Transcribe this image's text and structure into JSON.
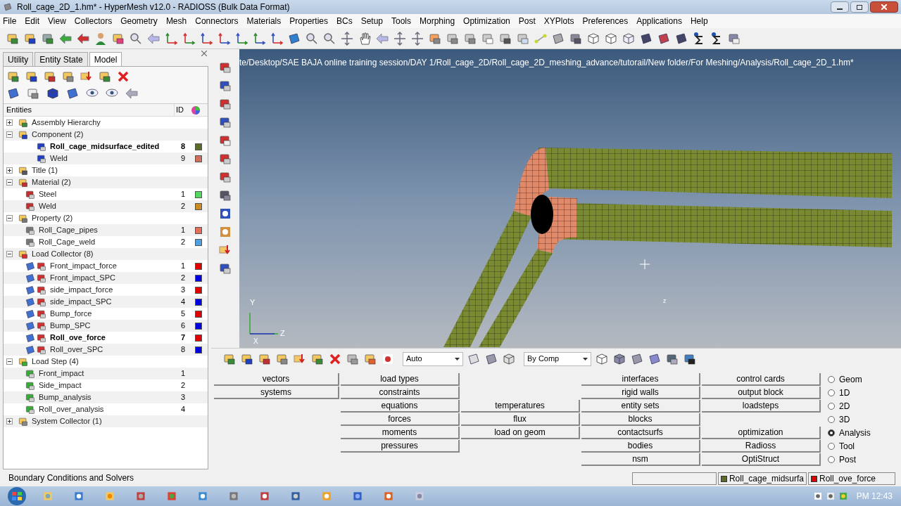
{
  "window": {
    "title": "Roll_cage_2D_1.hm* - HyperMesh v12.0 - RADIOSS (Bulk Data Format)"
  },
  "menu": [
    "File",
    "Edit",
    "View",
    "Collectors",
    "Geometry",
    "Mesh",
    "Connectors",
    "Materials",
    "Properties",
    "BCs",
    "Setup",
    "Tools",
    "Morphing",
    "Optimization",
    "Post",
    "XYPlots",
    "Preferences",
    "Applications",
    "Help"
  ],
  "browser": {
    "tabs": [
      {
        "label": "Utility",
        "selected": false
      },
      {
        "label": "Entity State",
        "selected": false
      },
      {
        "label": "Model",
        "selected": true
      }
    ],
    "columns": [
      "Entities",
      "ID"
    ],
    "tree": [
      {
        "label": "Assembly Hierarchy",
        "kind": "assembly",
        "expanded": false
      },
      {
        "label": "Component (2)",
        "kind": "component",
        "expanded": true,
        "children": [
          {
            "label": "Roll_cage_midsurface_edited",
            "kind": "component",
            "id": "8",
            "color": "#5a6b2a",
            "current": true
          },
          {
            "label": "Weld",
            "kind": "component",
            "id": "9",
            "color": "#d0705a",
            "current": false
          }
        ]
      },
      {
        "label": "Title (1)",
        "kind": "title",
        "expanded": false
      },
      {
        "label": "Material (2)",
        "kind": "material",
        "expanded": true,
        "children": [
          {
            "label": "Steel",
            "kind": "material",
            "id": "1",
            "color": "#50d860",
            "current": false
          },
          {
            "label": "Weld",
            "kind": "material",
            "id": "2",
            "color": "#c88c20",
            "current": false
          }
        ]
      },
      {
        "label": "Property (2)",
        "kind": "property",
        "expanded": true,
        "children": [
          {
            "label": "Roll_Cage_pipes",
            "kind": "property",
            "id": "1",
            "color": "#e07058",
            "current": false
          },
          {
            "label": "Roll_Cage_weld",
            "kind": "property",
            "id": "2",
            "color": "#50a0e0",
            "current": false
          }
        ]
      },
      {
        "label": "Load Collector (8)",
        "kind": "loadcol",
        "expanded": true,
        "children": [
          {
            "label": "Front_impact_force",
            "kind": "loadcol",
            "id": "1",
            "color": "#e00000",
            "current": false
          },
          {
            "label": "Front_impact_SPC",
            "kind": "loadcol",
            "id": "2",
            "color": "#0000e0",
            "current": false
          },
          {
            "label": "side_impact_force",
            "kind": "loadcol",
            "id": "3",
            "color": "#e00000",
            "current": false
          },
          {
            "label": "side_impact_SPC",
            "kind": "loadcol",
            "id": "4",
            "color": "#0000e0",
            "current": false
          },
          {
            "label": "Bump_force",
            "kind": "loadcol",
            "id": "5",
            "color": "#e00000",
            "current": false
          },
          {
            "label": "Bump_SPC",
            "kind": "loadcol",
            "id": "6",
            "color": "#0000e0",
            "current": false
          },
          {
            "label": "Roll_ove_force",
            "kind": "loadcol",
            "id": "7",
            "color": "#e00000",
            "current": true
          },
          {
            "label": "Roll_over_SPC",
            "kind": "loadcol",
            "id": "8",
            "color": "#0000e0",
            "current": false
          }
        ]
      },
      {
        "label": "Load Step (4)",
        "kind": "loadstep",
        "expanded": true,
        "children": [
          {
            "label": "Front_impact",
            "kind": "loadstep",
            "id": "1",
            "current": false
          },
          {
            "label": "Side_impact",
            "kind": "loadstep",
            "id": "2",
            "current": false
          },
          {
            "label": "Bump_analysis",
            "kind": "loadstep",
            "id": "3",
            "current": false
          },
          {
            "label": "Roll_over_analysis",
            "kind": "loadstep",
            "id": "4",
            "current": false
          }
        ]
      },
      {
        "label": "System Collector (1)",
        "kind": "system",
        "expanded": false
      }
    ]
  },
  "viewport": {
    "file_path": "te/Desktop/SAE BAJA online training session/DAY 1/Roll_cage_2D/Roll_cage_2D_meshing_advance/tutorail/New folder/For Meshing/Analysis/Roll_cage_2D_1.hm*",
    "axes": [
      "Y",
      "X",
      "Z"
    ],
    "marker_label": "z"
  },
  "bottom_toolbar": {
    "combos": [
      "Auto",
      "By Comp"
    ]
  },
  "panel": {
    "columns": [
      [
        {
          "label": "vectors"
        },
        {
          "label": "systems"
        },
        null,
        null,
        null,
        null,
        null
      ],
      [
        {
          "label": "load types"
        },
        {
          "label": "constraints"
        },
        {
          "label": "equations"
        },
        {
          "label": "forces"
        },
        {
          "label": "moments"
        },
        {
          "label": "pressures"
        },
        null
      ],
      [
        null,
        null,
        {
          "label": "temperatures"
        },
        {
          "label": "flux"
        },
        {
          "label": "load on geom"
        },
        null,
        null
      ],
      [
        {
          "label": "interfaces"
        },
        {
          "label": "rigid walls"
        },
        {
          "label": "entity sets"
        },
        {
          "label": "blocks"
        },
        {
          "label": "contactsurfs"
        },
        {
          "label": "bodies"
        },
        {
          "label": "nsm"
        }
      ],
      [
        {
          "label": "control cards"
        },
        {
          "label": "output block"
        },
        {
          "label": "loadsteps"
        },
        null,
        {
          "label": "optimization"
        },
        {
          "label": "Radioss"
        },
        {
          "label": "OptiStruct"
        }
      ]
    ],
    "modes": [
      {
        "label": "Geom",
        "selected": false
      },
      {
        "label": "1D",
        "selected": false
      },
      {
        "label": "2D",
        "selected": false
      },
      {
        "label": "3D",
        "selected": false
      },
      {
        "label": "Analysis",
        "selected": true
      },
      {
        "label": "Tool",
        "selected": false
      },
      {
        "label": "Post",
        "selected": false
      }
    ]
  },
  "status_bar": {
    "message": "Boundary Conditions and Solvers",
    "component": {
      "label": "Roll_cage_midsurfa",
      "color": "#5a6b2a"
    },
    "load_collector": {
      "label": "Roll_ove_force",
      "color": "#e00000"
    }
  },
  "taskbar": {
    "clock": "PM 12:43"
  }
}
